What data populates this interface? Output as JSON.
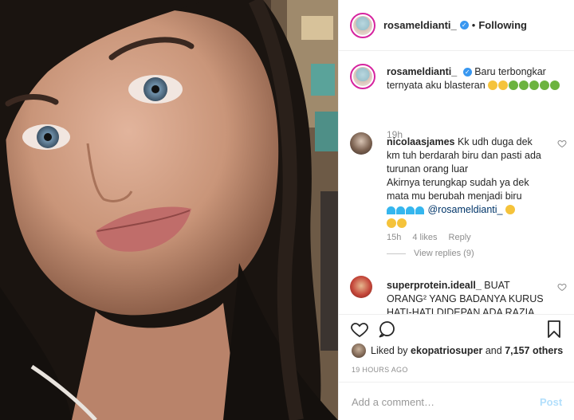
{
  "photo": {
    "alt": "selfie",
    "icon": "photo-image"
  },
  "header": {
    "username": "rosameldianti_",
    "verified_icon": "verified-badge-icon",
    "separator": "•",
    "follow_status": "Following"
  },
  "caption": {
    "username": "rosameldianti_",
    "text": "Baru terbongkar ternyata aku blasteran",
    "time": "19h"
  },
  "comments": [
    {
      "username": "nicolaasjames",
      "line1": "Kk udh duga dek km tuh berdarah biru dan pasti ada turunan orang luar",
      "line2": "Akirnya terungkap sudah ya dek mata mu berubah menjadi biru",
      "mention": "@rosameldianti_",
      "time": "15h",
      "likes": "4 likes",
      "reply": "Reply",
      "view_replies": "View replies (9)"
    },
    {
      "username": "superprotein.ideall_",
      "text": "BUAT ORANG² YANG BADANYA KURUS HATI-HATI DIDEPAN ADA RAZIA"
    }
  ],
  "actions": {
    "like_icon": "heart-icon",
    "comment_icon": "comment-icon",
    "save_icon": "bookmark-icon",
    "liked_prefix": "Liked by",
    "liked_user": "ekopatriosuper",
    "liked_and": "and",
    "liked_count": "7,157 others",
    "timestamp": "19 HOURS AGO"
  },
  "add_comment": {
    "placeholder": "Add a comment…",
    "post_label": "Post"
  },
  "colors": {
    "accent": "#3897f0",
    "post_disabled": "#b2dffc",
    "muted": "#8e8e8e"
  }
}
